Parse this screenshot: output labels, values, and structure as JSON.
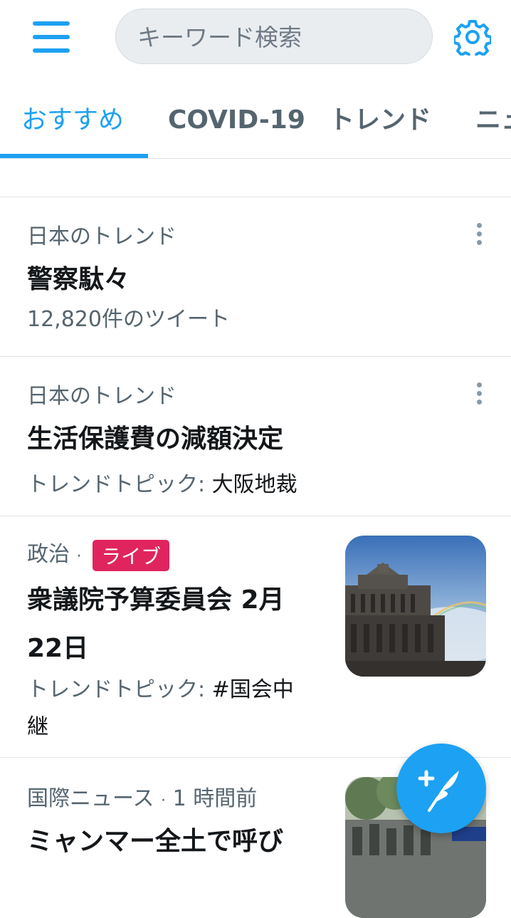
{
  "header": {
    "search_placeholder": "キーワード検索",
    "menu_icon": "hamburger-menu-icon",
    "settings_icon": "gear-icon",
    "accent_color": "#1da1f2"
  },
  "tabs": [
    {
      "label": "おすすめ",
      "active": true
    },
    {
      "label": "COVID-19",
      "active": false
    },
    {
      "label": "トレンド",
      "active": false
    },
    {
      "label": "ニュ",
      "active": false
    }
  ],
  "trends": [
    {
      "category": "日本のトレンド",
      "title": "警察駄々",
      "subtitle": "12,820件のツイート"
    },
    {
      "category": "日本のトレンド",
      "title": "生活保護費の減額決定",
      "topic_label": "トレンドトピック:",
      "topic_value": "大阪地裁"
    },
    {
      "category": "政治",
      "separator": "·",
      "badge": "ライブ",
      "title_line1": "衆議院予算委員会 2月",
      "title_line2": "22日",
      "topic_label": "トレンドトピック:",
      "topic_value_line1": "#国会中",
      "topic_value_line2": "継"
    },
    {
      "category": "国際ニュース",
      "separator": "·",
      "time": "1 時間前",
      "title": "ミャンマー全土で呼び"
    }
  ],
  "fab": {
    "icon": "compose-tweet-icon"
  }
}
